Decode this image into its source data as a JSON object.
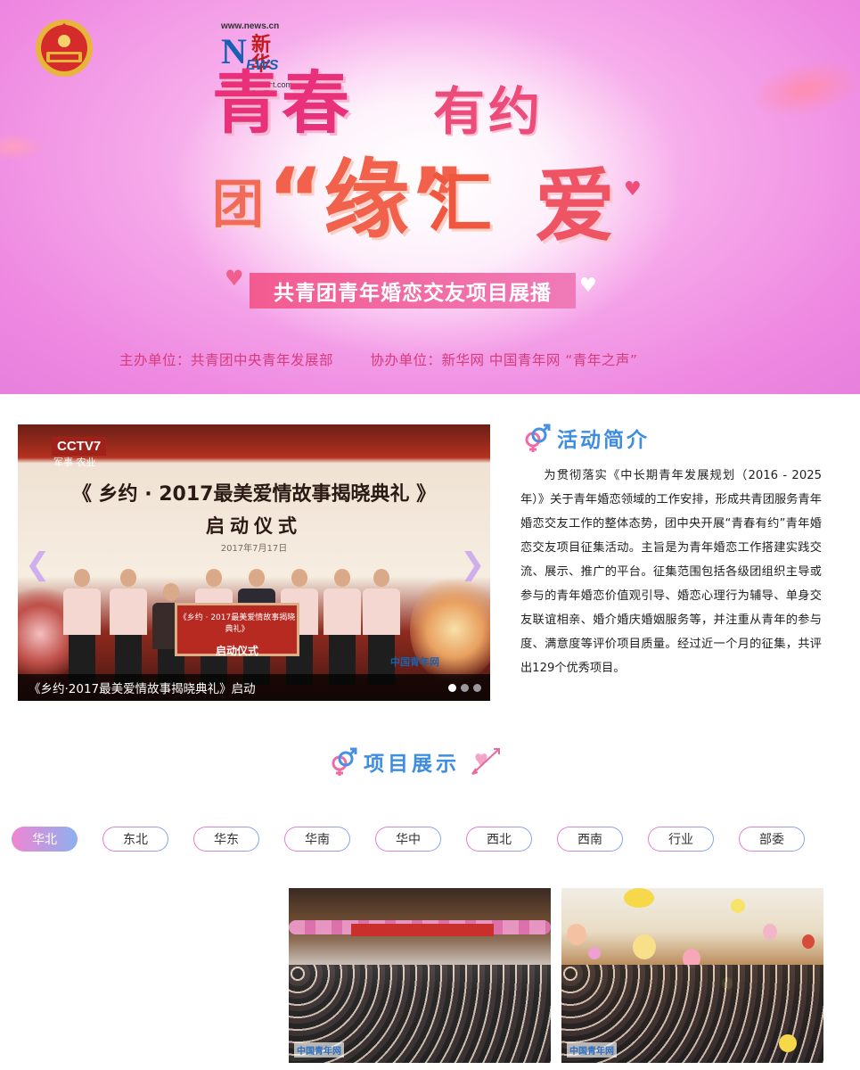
{
  "banner": {
    "title_line1a": "青春",
    "title_line1b": "有约",
    "title_line2a": "团",
    "title_line2b": "“缘”",
    "title_line2c": "汇",
    "title_line2d": "爱",
    "subtitle": "共青团青年婚恋交友项目展播",
    "organizer": "主办单位：共青团中央青年发展部",
    "co_organizer": "协办单位：新华网   中国青年网   “青年之声”",
    "news_logo": {
      "url_top": "www.news.cn",
      "letter": "N",
      "name_cn": "新华网",
      "ews": "EWS",
      "url_bottom": "www.xinhuanet.com"
    },
    "colors": {
      "background": "#f0a0e6",
      "title_pink": "#e8307b",
      "title_orange": "#f2614c"
    }
  },
  "carousel": {
    "slide_channel": "CCTV7",
    "slide_channel_sub": "军事 农业",
    "slide_title": "《 乡约 · 2017最美爱情故事揭晓典礼 》",
    "slide_subtitle": "启动仪式",
    "slide_date": "2017年7月17日",
    "sign_text": "《乡约 · 2017最美爱情故事揭晓典礼》",
    "sign_bold": "启动仪式",
    "watermark": "中国青年网",
    "caption": "《乡约·2017最美爱情故事揭晓典礼》启动",
    "dot_count": 3,
    "active_dot": 0,
    "prev_icon": "chevron-left-icon",
    "next_icon": "chevron-right-icon"
  },
  "intro": {
    "icon": "gender-symbol-icon",
    "title": "活动简介",
    "body": "为贯彻落实《中长期青年发展规划（2016 - 2025年）》关于青年婚恋领域的工作安排，形成共青团服务青年婚恋交友工作的整体态势，团中央开展“青春有约”青年婚恋交友项目征集活动。主旨是为青年婚恋工作搭建实践交流、展示、推广的平台。征集范围包括各级团组织主导或参与的青年婚恋价值观引导、婚恋心理行为辅导、单身交友联谊相亲、婚介婚庆婚姻服务等，并注重从青年的参与度、满意度等评价项目质量。经过近一个月的征集，共评出129个优秀项目。"
  },
  "projects": {
    "icon": "gender-symbol-icon",
    "deco_icon": "cupid-arrow-icon",
    "title": "项目展示",
    "tabs": [
      "华北",
      "东北",
      "华东",
      "华南",
      "华中",
      "西北",
      "西南",
      "行业",
      "部委"
    ],
    "active_tab": 0,
    "photo_watermark_1": "中国青年网",
    "photo_watermark_2": "中国青年网"
  }
}
